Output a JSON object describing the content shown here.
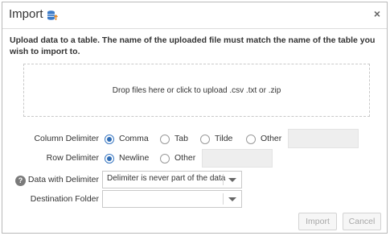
{
  "dialog": {
    "title": "Import",
    "close_symbol": "×",
    "description": "Upload data to a table. The name of the uploaded file must match the name of the table you wish to import to.",
    "dropzone_text": "Drop files here or click to upload .csv .txt or .zip"
  },
  "column_delimiter": {
    "label": "Column Delimiter",
    "options": [
      "Comma",
      "Tab",
      "Tilde",
      "Other"
    ],
    "selected": "Comma",
    "other_value": ""
  },
  "row_delimiter": {
    "label": "Row Delimiter",
    "options": [
      "Newline",
      "Other"
    ],
    "selected": "Newline",
    "other_value": ""
  },
  "data_with_delimiter": {
    "label": "Data with Delimiter",
    "value": "Delimiter is never part of the data",
    "help_icon": "question-icon"
  },
  "destination_folder": {
    "label": "Destination Folder",
    "value": ""
  },
  "buttons": {
    "import": "Import",
    "cancel": "Cancel"
  },
  "colors": {
    "accent": "#2f6db6",
    "disabled_text": "#a8a8a8",
    "field_disabled_bg": "#eeeeee"
  }
}
